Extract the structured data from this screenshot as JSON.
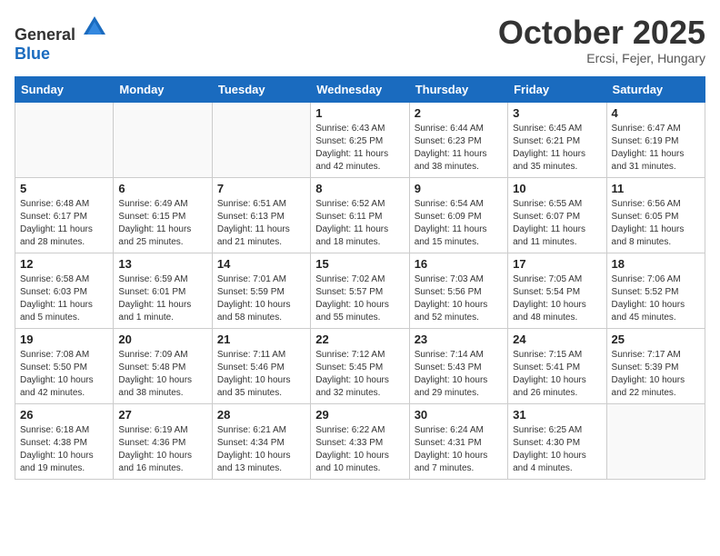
{
  "header": {
    "logo_general": "General",
    "logo_blue": "Blue",
    "month_title": "October 2025",
    "location": "Ercsi, Fejer, Hungary"
  },
  "days_of_week": [
    "Sunday",
    "Monday",
    "Tuesday",
    "Wednesday",
    "Thursday",
    "Friday",
    "Saturday"
  ],
  "weeks": [
    [
      {
        "day": "",
        "info": ""
      },
      {
        "day": "",
        "info": ""
      },
      {
        "day": "",
        "info": ""
      },
      {
        "day": "1",
        "info": "Sunrise: 6:43 AM\nSunset: 6:25 PM\nDaylight: 11 hours\nand 42 minutes."
      },
      {
        "day": "2",
        "info": "Sunrise: 6:44 AM\nSunset: 6:23 PM\nDaylight: 11 hours\nand 38 minutes."
      },
      {
        "day": "3",
        "info": "Sunrise: 6:45 AM\nSunset: 6:21 PM\nDaylight: 11 hours\nand 35 minutes."
      },
      {
        "day": "4",
        "info": "Sunrise: 6:47 AM\nSunset: 6:19 PM\nDaylight: 11 hours\nand 31 minutes."
      }
    ],
    [
      {
        "day": "5",
        "info": "Sunrise: 6:48 AM\nSunset: 6:17 PM\nDaylight: 11 hours\nand 28 minutes."
      },
      {
        "day": "6",
        "info": "Sunrise: 6:49 AM\nSunset: 6:15 PM\nDaylight: 11 hours\nand 25 minutes."
      },
      {
        "day": "7",
        "info": "Sunrise: 6:51 AM\nSunset: 6:13 PM\nDaylight: 11 hours\nand 21 minutes."
      },
      {
        "day": "8",
        "info": "Sunrise: 6:52 AM\nSunset: 6:11 PM\nDaylight: 11 hours\nand 18 minutes."
      },
      {
        "day": "9",
        "info": "Sunrise: 6:54 AM\nSunset: 6:09 PM\nDaylight: 11 hours\nand 15 minutes."
      },
      {
        "day": "10",
        "info": "Sunrise: 6:55 AM\nSunset: 6:07 PM\nDaylight: 11 hours\nand 11 minutes."
      },
      {
        "day": "11",
        "info": "Sunrise: 6:56 AM\nSunset: 6:05 PM\nDaylight: 11 hours\nand 8 minutes."
      }
    ],
    [
      {
        "day": "12",
        "info": "Sunrise: 6:58 AM\nSunset: 6:03 PM\nDaylight: 11 hours\nand 5 minutes."
      },
      {
        "day": "13",
        "info": "Sunrise: 6:59 AM\nSunset: 6:01 PM\nDaylight: 11 hours\nand 1 minute."
      },
      {
        "day": "14",
        "info": "Sunrise: 7:01 AM\nSunset: 5:59 PM\nDaylight: 10 hours\nand 58 minutes."
      },
      {
        "day": "15",
        "info": "Sunrise: 7:02 AM\nSunset: 5:57 PM\nDaylight: 10 hours\nand 55 minutes."
      },
      {
        "day": "16",
        "info": "Sunrise: 7:03 AM\nSunset: 5:56 PM\nDaylight: 10 hours\nand 52 minutes."
      },
      {
        "day": "17",
        "info": "Sunrise: 7:05 AM\nSunset: 5:54 PM\nDaylight: 10 hours\nand 48 minutes."
      },
      {
        "day": "18",
        "info": "Sunrise: 7:06 AM\nSunset: 5:52 PM\nDaylight: 10 hours\nand 45 minutes."
      }
    ],
    [
      {
        "day": "19",
        "info": "Sunrise: 7:08 AM\nSunset: 5:50 PM\nDaylight: 10 hours\nand 42 minutes."
      },
      {
        "day": "20",
        "info": "Sunrise: 7:09 AM\nSunset: 5:48 PM\nDaylight: 10 hours\nand 38 minutes."
      },
      {
        "day": "21",
        "info": "Sunrise: 7:11 AM\nSunset: 5:46 PM\nDaylight: 10 hours\nand 35 minutes."
      },
      {
        "day": "22",
        "info": "Sunrise: 7:12 AM\nSunset: 5:45 PM\nDaylight: 10 hours\nand 32 minutes."
      },
      {
        "day": "23",
        "info": "Sunrise: 7:14 AM\nSunset: 5:43 PM\nDaylight: 10 hours\nand 29 minutes."
      },
      {
        "day": "24",
        "info": "Sunrise: 7:15 AM\nSunset: 5:41 PM\nDaylight: 10 hours\nand 26 minutes."
      },
      {
        "day": "25",
        "info": "Sunrise: 7:17 AM\nSunset: 5:39 PM\nDaylight: 10 hours\nand 22 minutes."
      }
    ],
    [
      {
        "day": "26",
        "info": "Sunrise: 6:18 AM\nSunset: 4:38 PM\nDaylight: 10 hours\nand 19 minutes."
      },
      {
        "day": "27",
        "info": "Sunrise: 6:19 AM\nSunset: 4:36 PM\nDaylight: 10 hours\nand 16 minutes."
      },
      {
        "day": "28",
        "info": "Sunrise: 6:21 AM\nSunset: 4:34 PM\nDaylight: 10 hours\nand 13 minutes."
      },
      {
        "day": "29",
        "info": "Sunrise: 6:22 AM\nSunset: 4:33 PM\nDaylight: 10 hours\nand 10 minutes."
      },
      {
        "day": "30",
        "info": "Sunrise: 6:24 AM\nSunset: 4:31 PM\nDaylight: 10 hours\nand 7 minutes."
      },
      {
        "day": "31",
        "info": "Sunrise: 6:25 AM\nSunset: 4:30 PM\nDaylight: 10 hours\nand 4 minutes."
      },
      {
        "day": "",
        "info": ""
      }
    ]
  ]
}
